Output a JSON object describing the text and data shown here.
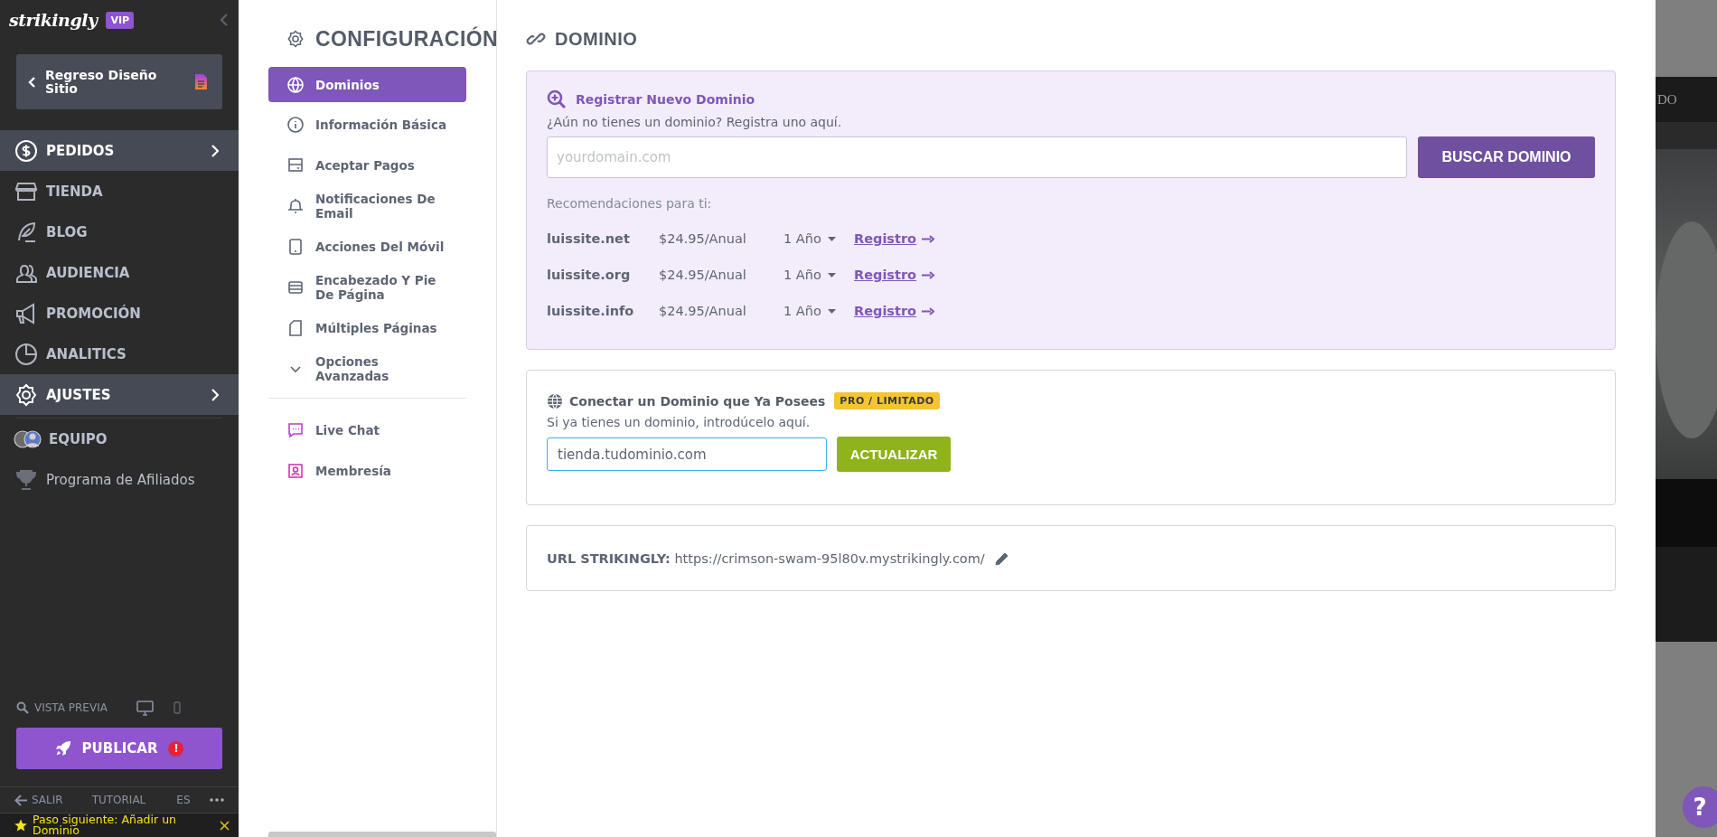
{
  "sidebar": {
    "logo": "strikingly",
    "badge": "VIP",
    "back_button": "Regreso Diseño Sitio",
    "nav_items": [
      {
        "label": "PEDIDOS",
        "highlighted": true
      },
      {
        "label": "TIENDA",
        "highlighted": false
      },
      {
        "label": "BLOG",
        "highlighted": false
      },
      {
        "label": "AUDIENCIA",
        "highlighted": false
      },
      {
        "label": "PROMOCIÓN",
        "highlighted": false
      },
      {
        "label": "ANALITICS",
        "highlighted": false
      },
      {
        "label": "AJUSTES",
        "highlighted": true
      }
    ],
    "extra_items": [
      {
        "label": "EQUIPO",
        "kind": "team"
      },
      {
        "label": "Programa de Afiliados",
        "kind": "affiliate"
      }
    ],
    "preview": "VISTA PREVIA",
    "publish_button": "PUBLICAR",
    "publish_alert": "!",
    "footer": [
      "SALIR",
      "TUTORIAL",
      "ES"
    ],
    "notice": "Paso siguiente: Añadir un Dominio"
  },
  "settings_menu": {
    "title": "CONFIGURACIÓN",
    "items": [
      {
        "label": "Dominios",
        "selected": true
      },
      {
        "label": "Información Básica",
        "selected": false
      },
      {
        "label": "Aceptar Pagos",
        "selected": false
      },
      {
        "label": "Notificaciones De Email",
        "selected": false
      },
      {
        "label": "Acciones Del Móvil",
        "selected": false
      },
      {
        "label": "Encabezado Y Pie De Página",
        "selected": false
      },
      {
        "label": "Múltiples Páginas",
        "selected": false
      },
      {
        "label": "Opciones Avanzadas",
        "selected": false
      }
    ],
    "extra_items": [
      {
        "label": "Live Chat",
        "selected": false
      },
      {
        "label": "Membresía",
        "selected": false
      }
    ]
  },
  "domain": {
    "title": "DOMINIO",
    "register": {
      "heading": "Registrar Nuevo Dominio",
      "subtitle": "¿Aún no tienes un dominio? Registra uno aquí.",
      "placeholder": "yourdomain.com",
      "button": "BUSCAR DOMINIO",
      "recommendations_label": "Recomendaciones para ti:",
      "rows": [
        {
          "domain": "luissite.net",
          "price": "$24.95/Anual",
          "term": "1 Año",
          "link": "Registro"
        },
        {
          "domain": "luissite.org",
          "price": "$24.95/Anual",
          "term": "1 Año",
          "link": "Registro"
        },
        {
          "domain": "luissite.info",
          "price": "$24.95/Anual",
          "term": "1 Año",
          "link": "Registro"
        }
      ]
    },
    "connect": {
      "heading": "Conectar un Dominio que Ya Posees",
      "badge": "PRO / LIMITADO",
      "subtitle": "Si ya tienes un dominio, introdúcelo aquí.",
      "value": "tienda.tudominio.com",
      "focused": true,
      "button": "ACTUALIZAR"
    },
    "url": {
      "label": "URL STRIKINGLY:",
      "value": "https://crimson-swam-95l80v.mystrikingly.com/"
    }
  },
  "backdrop": {
    "bar_text": "DO",
    "help_button": "?"
  }
}
